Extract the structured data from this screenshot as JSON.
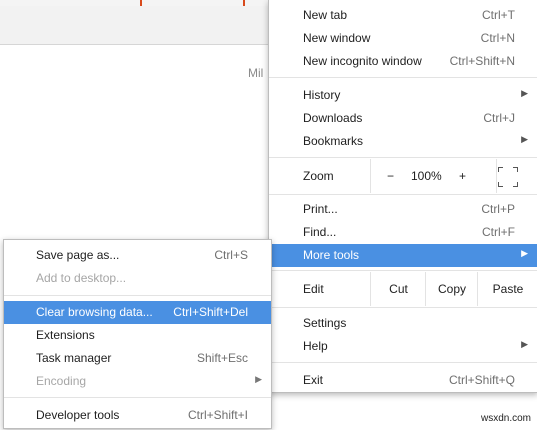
{
  "page": {
    "truncated_text": "Mil",
    "watermark": "wsxdn.com"
  },
  "main_menu": {
    "new_tab": {
      "label": "New tab",
      "shortcut": "Ctrl+T"
    },
    "new_window": {
      "label": "New window",
      "shortcut": "Ctrl+N"
    },
    "new_incognito": {
      "label": "New incognito window",
      "shortcut": "Ctrl+Shift+N"
    },
    "history": {
      "label": "History"
    },
    "downloads": {
      "label": "Downloads",
      "shortcut": "Ctrl+J"
    },
    "bookmarks": {
      "label": "Bookmarks"
    },
    "zoom": {
      "label": "Zoom",
      "minus": "−",
      "value": "100%",
      "plus": "+"
    },
    "print": {
      "label": "Print...",
      "shortcut": "Ctrl+P"
    },
    "find": {
      "label": "Find...",
      "shortcut": "Ctrl+F"
    },
    "more_tools": {
      "label": "More tools"
    },
    "edit": {
      "label": "Edit",
      "cut": "Cut",
      "copy": "Copy",
      "paste": "Paste"
    },
    "settings": {
      "label": "Settings"
    },
    "help": {
      "label": "Help"
    },
    "exit": {
      "label": "Exit",
      "shortcut": "Ctrl+Shift+Q"
    }
  },
  "sub_menu": {
    "save_page": {
      "label": "Save page as...",
      "shortcut": "Ctrl+S"
    },
    "add_desktop": {
      "label": "Add to desktop..."
    },
    "clear_data": {
      "label": "Clear browsing data...",
      "shortcut": "Ctrl+Shift+Del"
    },
    "extensions": {
      "label": "Extensions"
    },
    "task_manager": {
      "label": "Task manager",
      "shortcut": "Shift+Esc"
    },
    "encoding": {
      "label": "Encoding"
    },
    "dev_tools": {
      "label": "Developer tools",
      "shortcut": "Ctrl+Shift+I"
    }
  },
  "colors": {
    "highlight": "#4a90e2",
    "accent_mark": "#d84a1b"
  }
}
